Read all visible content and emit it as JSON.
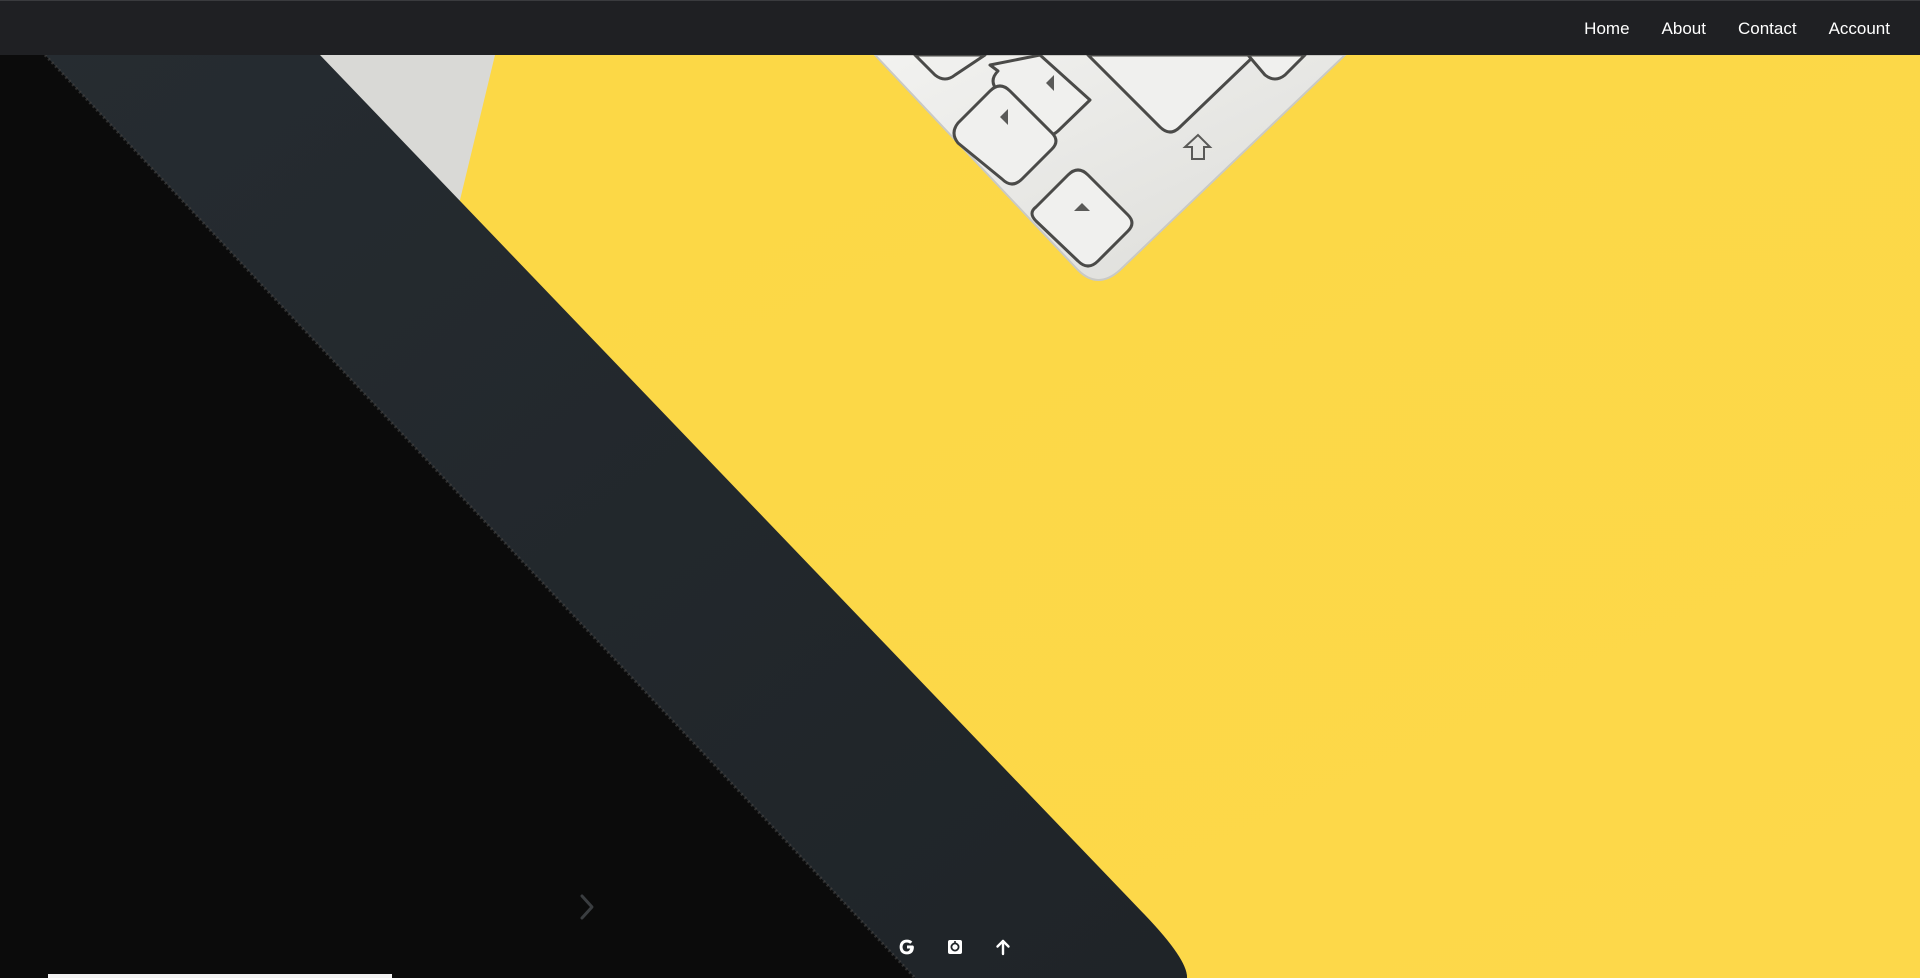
{
  "navbar": {
    "links": [
      {
        "label": "Home"
      },
      {
        "label": "About"
      },
      {
        "label": "Contact"
      },
      {
        "label": "Account"
      }
    ]
  },
  "hero": {
    "icons": {
      "next": "chevron-right-icon"
    }
  },
  "footer": {
    "icons": [
      "google-icon",
      "app-icon",
      "arrow-up-icon"
    ]
  },
  "colors": {
    "navbar_bg": "#1f2023",
    "yellow": "#fdd947",
    "laptop_bezel": "#23282c",
    "laptop_screen": "#0b0b0b",
    "keyboard": "#ebebe8"
  }
}
